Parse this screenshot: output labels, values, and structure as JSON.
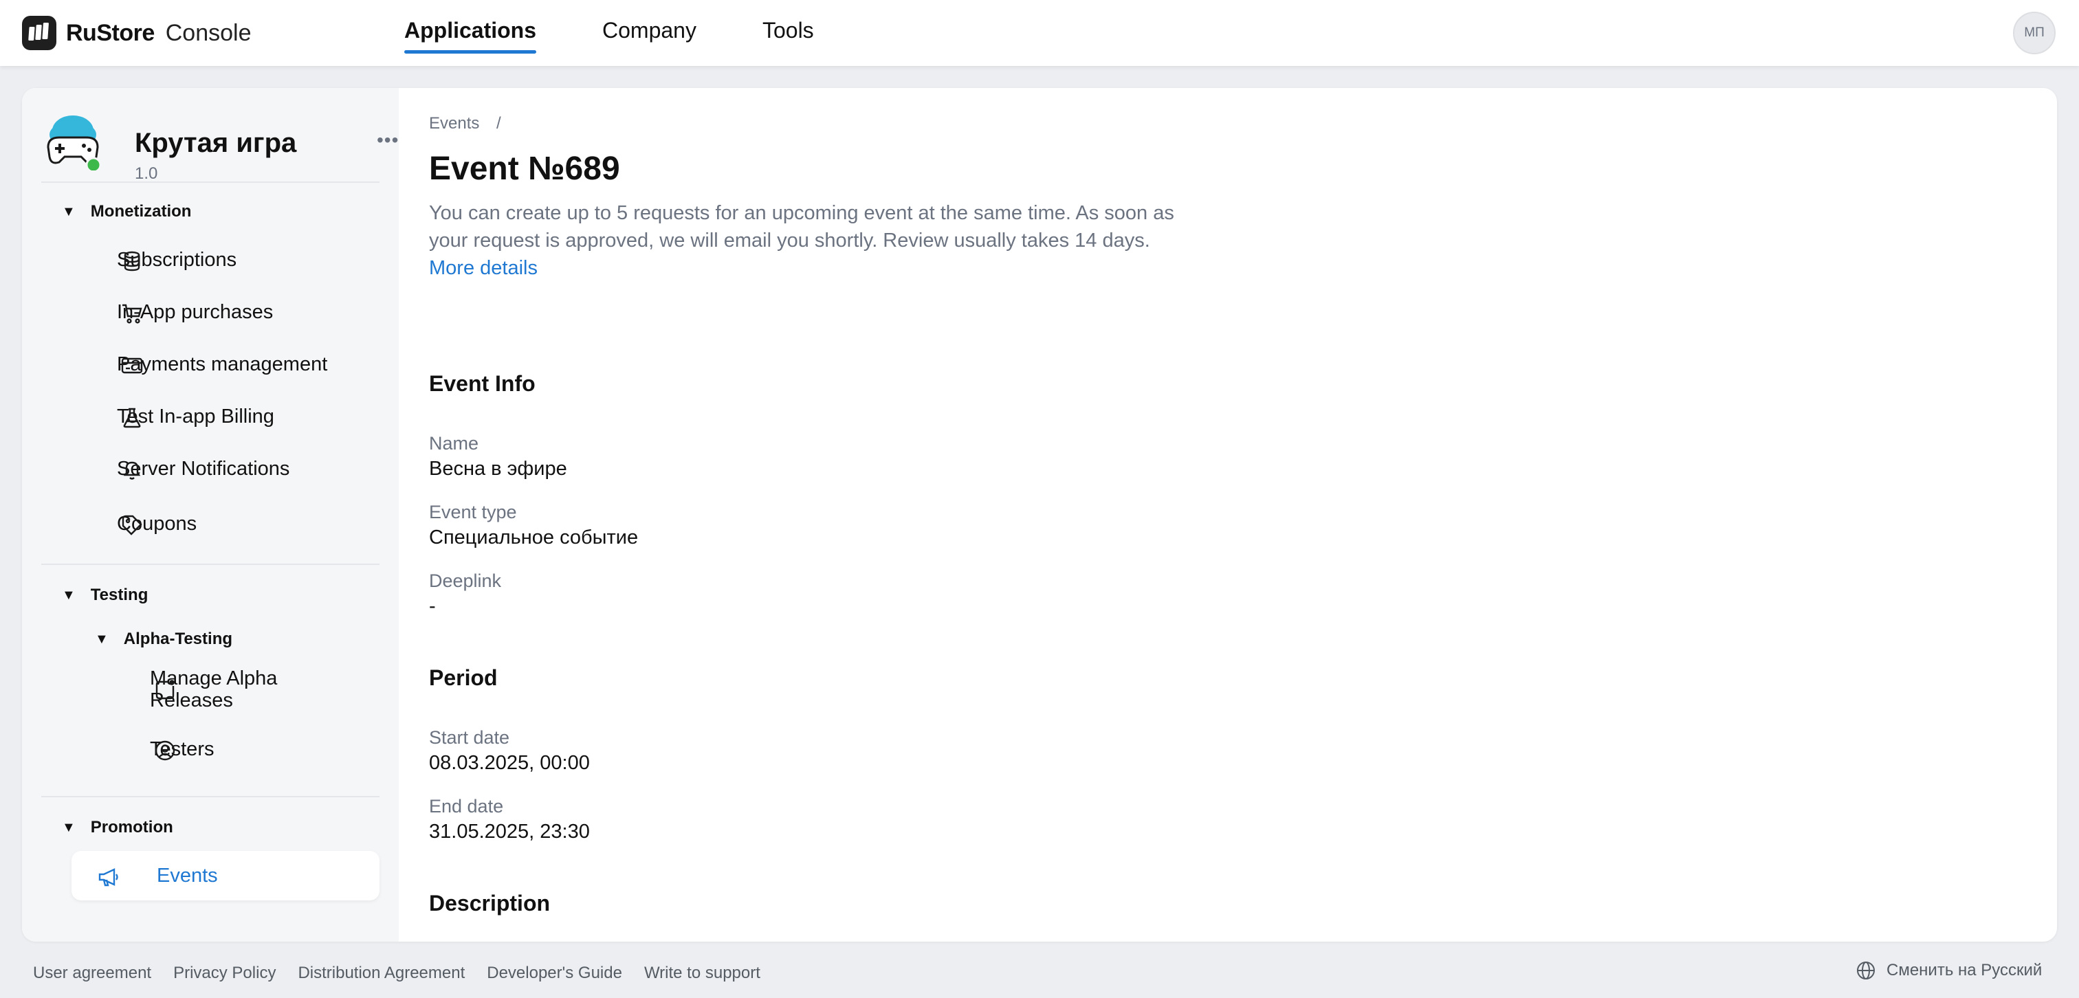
{
  "header": {
    "brand_name": "RuStore",
    "brand_sub": "Console",
    "nav": [
      "Applications",
      "Company",
      "Tools"
    ],
    "active_nav": "Applications",
    "avatar_initials": "МП"
  },
  "app": {
    "name": "Крутая игра",
    "version": "1.0",
    "more_label": "•••"
  },
  "sidebar": {
    "monetization": {
      "title": "Monetization",
      "items": [
        "Subscriptions",
        "In-App purchases",
        "Payments management",
        "Test In-app Billing",
        "Server Notifications",
        "Coupons"
      ]
    },
    "testing": {
      "title": "Testing",
      "sub_title": "Alpha-Testing",
      "items": [
        "Manage Alpha Releases",
        "Testers"
      ]
    },
    "promotion": {
      "title": "Promotion",
      "items": [
        "Events"
      ]
    }
  },
  "content": {
    "breadcrumb": "Events",
    "breadcrumb_sep": "/",
    "title": "Event №689",
    "intro": "You can create up to 5 requests for an upcoming event at the same time. As soon as your request is approved, we will email you shortly. Review usually takes 14 days.",
    "more_details": "More details",
    "event_info": {
      "heading": "Event Info",
      "name_label": "Name",
      "name_value": "Весна в эфире",
      "type_label": "Event type",
      "type_value": "Специальное событие",
      "deeplink_label": "Deeplink",
      "deeplink_value": "-"
    },
    "period": {
      "heading": "Period",
      "start_label": "Start date",
      "start_value": "08.03.2025, 00:00",
      "end_label": "End date",
      "end_value": "31.05.2025, 23:30"
    },
    "description_heading": "Description"
  },
  "footer": {
    "links": [
      "User agreement",
      "Privacy Policy",
      "Distribution Agreement",
      "Developer's Guide",
      "Write to support"
    ],
    "language": "Сменить на Русский"
  },
  "colors": {
    "accent": "#1f78d1",
    "muted_text": "#6b7280",
    "sidebar_bg": "#f5f6f8",
    "status_green": "#3cb94a"
  }
}
